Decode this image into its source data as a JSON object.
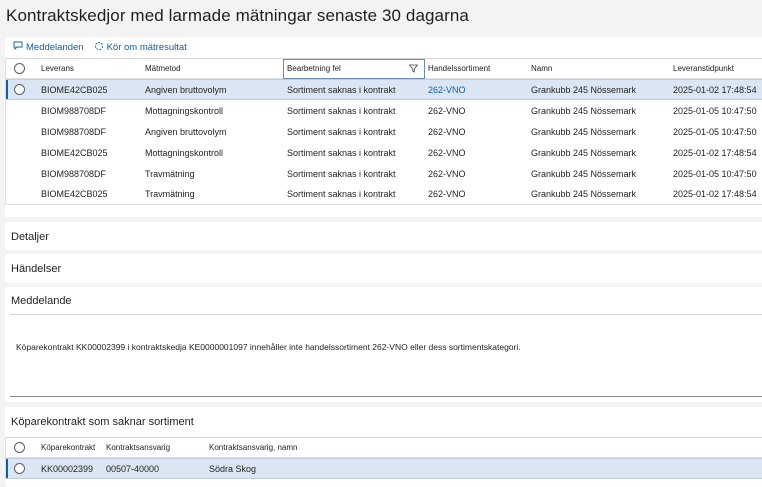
{
  "page": {
    "title": "Kontraktskedjor med larmade mätningar senaste 30 dagarna"
  },
  "toolbar": {
    "messages_label": "Meddelanden",
    "rerun_label": "Kör om mätresultat"
  },
  "grid": {
    "columns": [
      "Leverans",
      "Mätmetod",
      "Bearbetning fel",
      "Handelssortiment",
      "Namn",
      "Leveranstidpunkt"
    ],
    "rows": [
      [
        "BIOME42CB025",
        "Angiven bruttovolym",
        "Sortiment saknas i kontrakt",
        "262-VNO",
        "Grankubb 245 Nössemark",
        "2025-01-02 17:48:54"
      ],
      [
        "BIOM988708DF",
        "Mottagningskontroll",
        "Sortiment saknas i kontrakt",
        "262-VNO",
        "Grankubb 245 Nössemark",
        "2025-01-05 10:47:50"
      ],
      [
        "BIOM988708DF",
        "Angiven bruttovolym",
        "Sortiment saknas i kontrakt",
        "262-VNO",
        "Grankubb 245 Nössemark",
        "2025-01-05 10:47:50"
      ],
      [
        "BIOME42CB025",
        "Mottagningskontroll",
        "Sortiment saknas i kontrakt",
        "262-VNO",
        "Grankubb 245 Nössemark",
        "2025-01-02 17:48:54"
      ],
      [
        "BIOM988708DF",
        "Travmätning",
        "Sortiment saknas i kontrakt",
        "262-VNO",
        "Grankubb 245 Nössemark",
        "2025-01-05 10:47:50"
      ],
      [
        "BIOME42CB025",
        "Travmätning",
        "Sortiment saknas i kontrakt",
        "262-VNO",
        "Grankubb 245 Nössemark",
        "2025-01-02 17:48:54"
      ]
    ]
  },
  "sections": {
    "details": "Detaljer",
    "events": "Händelser",
    "message": "Meddelande",
    "message_text": "Köparekontrakt KK00002399 i kontraktskedja KE0000001097 innehåller inte handelssortiment 262-VNO eller dess sortimentskategori.",
    "missing": "Köparekontrakt som saknar sortiment"
  },
  "grid2": {
    "columns": [
      "Köparekontrakt",
      "Kontraktsansvarig",
      "Kontraktsansvarig, namn"
    ],
    "rows": [
      [
        "KK00002399",
        "00507-40000",
        "Södra Skog"
      ]
    ]
  },
  "colors": {
    "accent": "#0f5ea8",
    "selected_row": "#dbe6f4"
  }
}
